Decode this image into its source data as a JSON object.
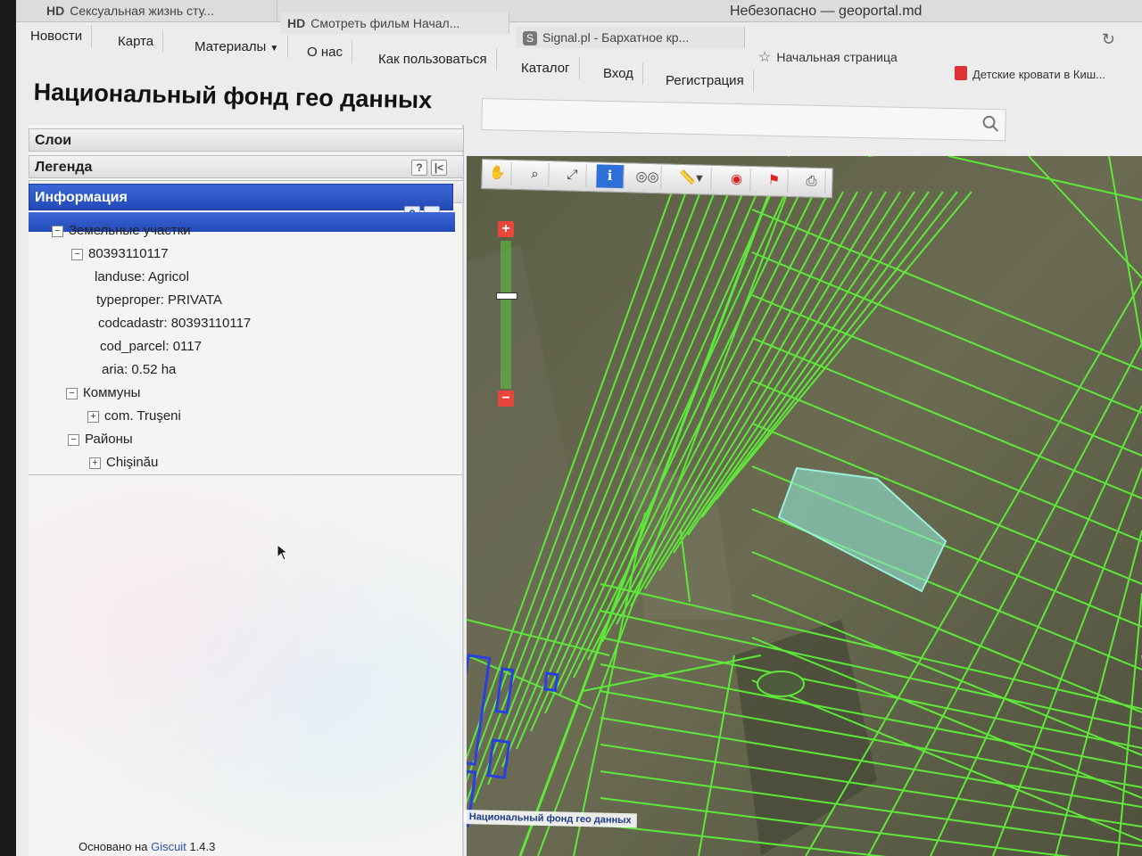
{
  "browser": {
    "window_title": "Небезопасно — geoportal.md",
    "tabs": [
      {
        "prefix": "HD",
        "label": "Сексуальная жизнь сту..."
      },
      {
        "prefix": "HD",
        "label": "Смотреть фильм Начал..."
      },
      {
        "prefix": "S",
        "label": "Signal.pl - Бархатное кр..."
      }
    ],
    "bookmarks": [
      "Начальная страница",
      "Детские кровати в Киш..."
    ]
  },
  "nav": {
    "items": [
      "Новости",
      "Карта",
      "Материалы",
      "О нас",
      "Как пользоваться",
      "Каталог",
      "Вход",
      "Регистрация"
    ]
  },
  "page": {
    "title": "Национальный фонд гео данных",
    "search_placeholder": ""
  },
  "panels": {
    "layers": "Слои",
    "legend": "Легенда",
    "info": "Информация",
    "btn_help": "?",
    "btn_collapse": "|<",
    "btn_plus": "+",
    "btn_minus": "−"
  },
  "tree": {
    "group1": "Земельные участки",
    "parcel_id": "80393110117",
    "attrs": [
      "landuse: Agricol",
      "typeproper: PRIVATA",
      "codcadastr: 80393110117",
      "cod_parcel: 0117",
      "aria: 0.52 ha"
    ],
    "group2": "Коммуны",
    "group2_child": "com. Truşeni",
    "group3": "Районы",
    "group3_child": "Chişinău"
  },
  "footer": {
    "prefix": "Основано на",
    "link": "Giscuit",
    "version": "1.4.3"
  },
  "map": {
    "credit": "Национальный фонд гео данных",
    "toolbar_icons": [
      "pan-icon",
      "zoom-icon",
      "fullextent-icon",
      "info-icon",
      "binoculars-icon",
      "measure-icon",
      "point-icon",
      "flag-icon",
      "print-icon"
    ],
    "zoom_in": "+",
    "zoom_out": "−",
    "parcel_color": "#5ee83a",
    "selected_color": "#8fe6d2",
    "building_color": "#2a3fe0"
  }
}
